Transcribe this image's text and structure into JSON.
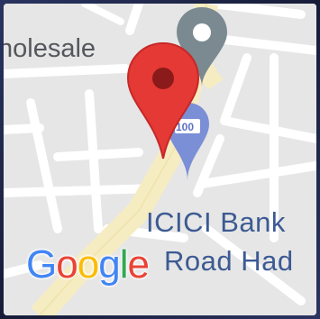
{
  "map": {
    "labels": {
      "wholesale": "holesale",
      "bank": "ICICI Bank",
      "road": "Road Had"
    },
    "atm_badge": "100",
    "markers": [
      {
        "name": "selected-location",
        "color": "#e53935"
      },
      {
        "name": "place",
        "color": "#7a8a90"
      },
      {
        "name": "atm",
        "color": "#7b8fd6"
      }
    ],
    "logo": {
      "letters": [
        "G",
        "o",
        "o",
        "g",
        "l",
        "e"
      ],
      "colors": [
        "#4285f4",
        "#ea4335",
        "#fbbc05",
        "#4285f4",
        "#34a853",
        "#ea4335"
      ]
    }
  }
}
